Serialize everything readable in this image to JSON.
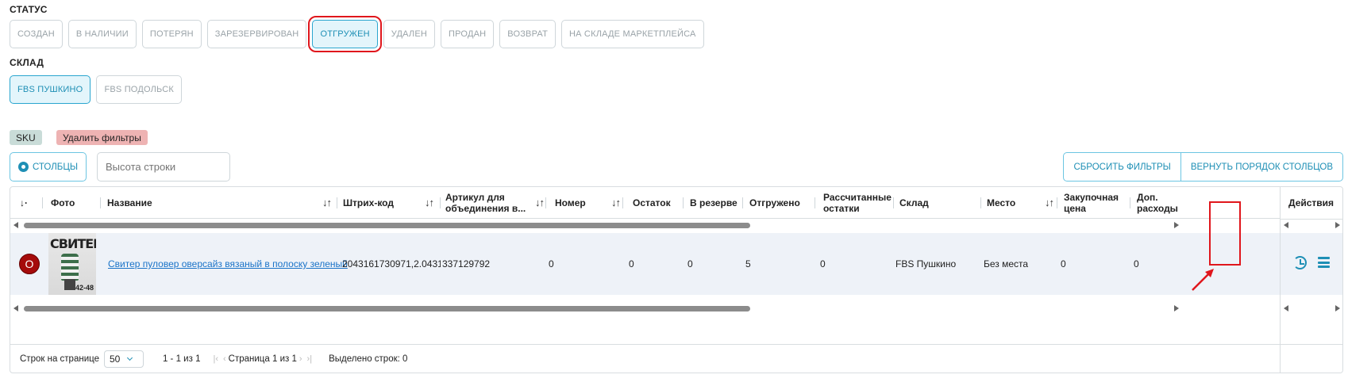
{
  "status": {
    "title": "СТАТУС",
    "chips": [
      {
        "label": "СОЗДАН",
        "active": false
      },
      {
        "label": "В НАЛИЧИИ",
        "active": false
      },
      {
        "label": "ПОТЕРЯН",
        "active": false
      },
      {
        "label": "ЗАРЕЗЕРВИРОВАН",
        "active": false
      },
      {
        "label": "ОТГРУЖЕН",
        "active": true
      },
      {
        "label": "УДАЛЕН",
        "active": false
      },
      {
        "label": "ПРОДАН",
        "active": false
      },
      {
        "label": "ВОЗВРАТ",
        "active": false
      },
      {
        "label": "НА СКЛАДЕ МАРКЕТПЛЕЙСА",
        "active": false
      }
    ]
  },
  "warehouse": {
    "title": "СКЛАД",
    "chips": [
      {
        "label": "FBS ПУШКИНО",
        "active": true
      },
      {
        "label": "FBS ПОДОЛЬСК",
        "active": false
      }
    ]
  },
  "tags": {
    "sku": "SKU",
    "remove_filters": "Удалить фильтры"
  },
  "toolbar": {
    "columns_label": "СТОЛБЦЫ",
    "row_height_placeholder": "Высота строки",
    "reset_filters_label": "СБРОСИТЬ ФИЛЬТРЫ",
    "restore_columns_label": "ВЕРНУТЬ ПОРЯДОК СТОЛБЦОВ"
  },
  "table": {
    "headers": {
      "photo": "Фото",
      "name": "Название",
      "barcode": "Штрих-код",
      "article_1": "Артикул для",
      "article_2": "объединения в...",
      "number": "Номер",
      "remainder": "Остаток",
      "reserve": "В резерве",
      "shipped": "Отгружено",
      "calc_1": "Рассчитанные",
      "calc_2": "остатки",
      "warehouse": "Склад",
      "place": "Место",
      "purchase_1": "Закупочная",
      "purchase_2": "цена",
      "extra_1": "Доп.",
      "extra_2": "расходы",
      "actions": "Действия",
      "sort_glyph": "↓↑",
      "select_glyph": "↓·"
    },
    "row": {
      "avatar": "О",
      "photo_title": "СВИТЕР",
      "photo_size": "42-48",
      "name": "Свитер пуловер оверсайз вязаный в полоску зеленый",
      "barcode": "2043161730971,2.0431",
      "article": "337129792",
      "number": "0",
      "remainder": "0",
      "reserve": "0",
      "shipped": "5",
      "calculated": "0",
      "warehouse": "FBS Пушкино",
      "place": "Без места",
      "purchase_price": "0",
      "extra_costs": "0"
    }
  },
  "footer": {
    "rows_per_page_label": "Строк на странице",
    "rows_per_page_value": "50",
    "range": "1 - 1 из 1",
    "page_info": "Страница 1 из 1",
    "selected": "Выделено строк: 0"
  },
  "colors": {
    "accent": "#1e8fb5",
    "highlight": "#e0161c",
    "row_bg": "#eef2f8"
  }
}
